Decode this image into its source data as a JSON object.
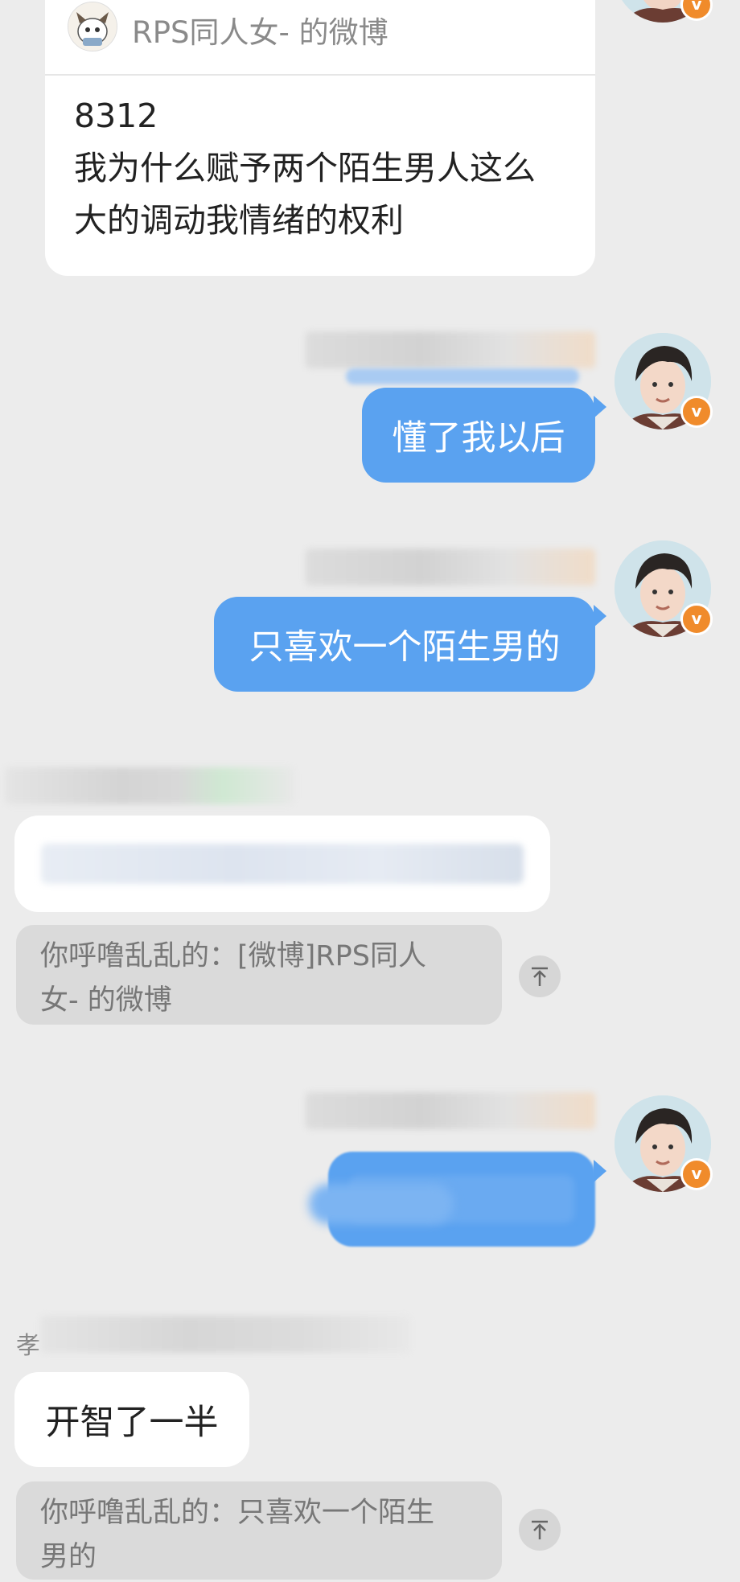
{
  "shared_post": {
    "source_title": "RPS同人女- 的微博",
    "lines": [
      "8312",
      "我为什么赋予两个陌生男人这么",
      "大的调动我情绪的权利"
    ]
  },
  "messages": [
    {
      "id": "m1",
      "side": "right",
      "text": "懂了我以后"
    },
    {
      "id": "m2",
      "side": "right",
      "text": "只喜欢一个陌生男的"
    },
    {
      "id": "m3",
      "side": "left",
      "text": ""
    },
    {
      "id": "m4",
      "side": "right",
      "text": ""
    },
    {
      "id": "m5",
      "side": "left",
      "text": "开智了一半"
    }
  ],
  "quotes": [
    {
      "line1": "你呼噜乱乱的：[微博]RPS同人",
      "line2": "女- 的微博"
    },
    {
      "line1": "你呼噜乱乱的：只喜欢一个陌生",
      "line2": "男的"
    }
  ],
  "partial_name_prefix": "孝",
  "badge_glyph": "v",
  "colors": {
    "background": "#ececec",
    "outgoing_bubble": "#5aa2f0",
    "incoming_bubble": "#ffffff",
    "quote_bg": "#dadada",
    "verified_badge": "#f08b2b"
  }
}
